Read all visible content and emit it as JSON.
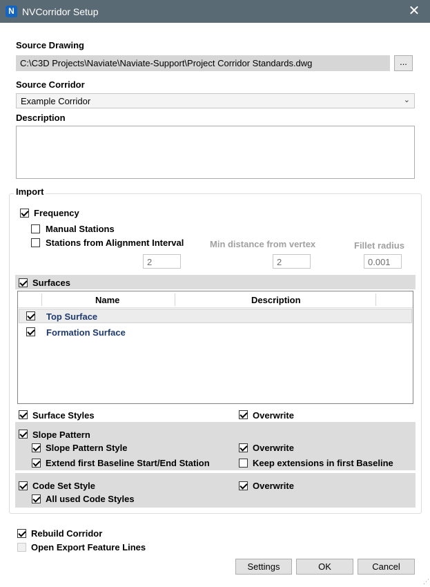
{
  "window": {
    "title": "NVCorridor Setup",
    "app_icon_letter": "N",
    "close_glyph": "✕"
  },
  "source_drawing": {
    "label": "Source Drawing",
    "path": "C:\\C3D Projects\\Naviate\\Naviate-Support\\Project Corridor Standards.dwg",
    "browse_label": "..."
  },
  "source_corridor": {
    "label": "Source Corridor",
    "selected": "Example Corridor"
  },
  "description": {
    "label": "Description",
    "value": ""
  },
  "import": {
    "title": "Import",
    "frequency": {
      "label": "Frequency",
      "checked": true
    },
    "manual_stations": {
      "label": "Manual Stations",
      "checked": false
    },
    "stations_alignment": {
      "label": "Stations from Alignment Interval",
      "checked": false,
      "value": "2"
    },
    "min_distance": {
      "label": "Min distance from vertex",
      "value": "2"
    },
    "fillet_radius": {
      "label": "Fillet radius",
      "value": "0.001"
    },
    "surfaces": {
      "label": "Surfaces",
      "checked": true,
      "columns": [
        "Name",
        "Description"
      ],
      "rows": [
        {
          "name": "Top Surface",
          "description": "",
          "checked": true
        },
        {
          "name": "Formation Surface",
          "description": "",
          "checked": true
        }
      ]
    },
    "surface_styles": {
      "label": "Surface Styles",
      "checked": true,
      "overwrite_label": "Overwrite",
      "overwrite": true
    },
    "slope_pattern": {
      "label": "Slope Pattern",
      "checked": true,
      "style": {
        "label": "Slope Pattern Style",
        "checked": true,
        "overwrite_label": "Overwrite",
        "overwrite": true
      },
      "extend": {
        "label": "Extend first Baseline Start/End Station",
        "checked": true
      },
      "keep_ext": {
        "label": "Keep extensions in first Baseline",
        "checked": false
      }
    },
    "code_set_style": {
      "label": "Code Set Style",
      "checked": true,
      "overwrite_label": "Overwrite",
      "overwrite": true,
      "all_used": {
        "label": "All used Code Styles",
        "checked": true
      }
    }
  },
  "rebuild_corridor": {
    "label": "Rebuild Corridor",
    "checked": true
  },
  "open_export": {
    "label": "Open Export Feature Lines",
    "checked": false
  },
  "buttons": {
    "settings": "Settings",
    "ok": "OK",
    "cancel": "Cancel"
  }
}
